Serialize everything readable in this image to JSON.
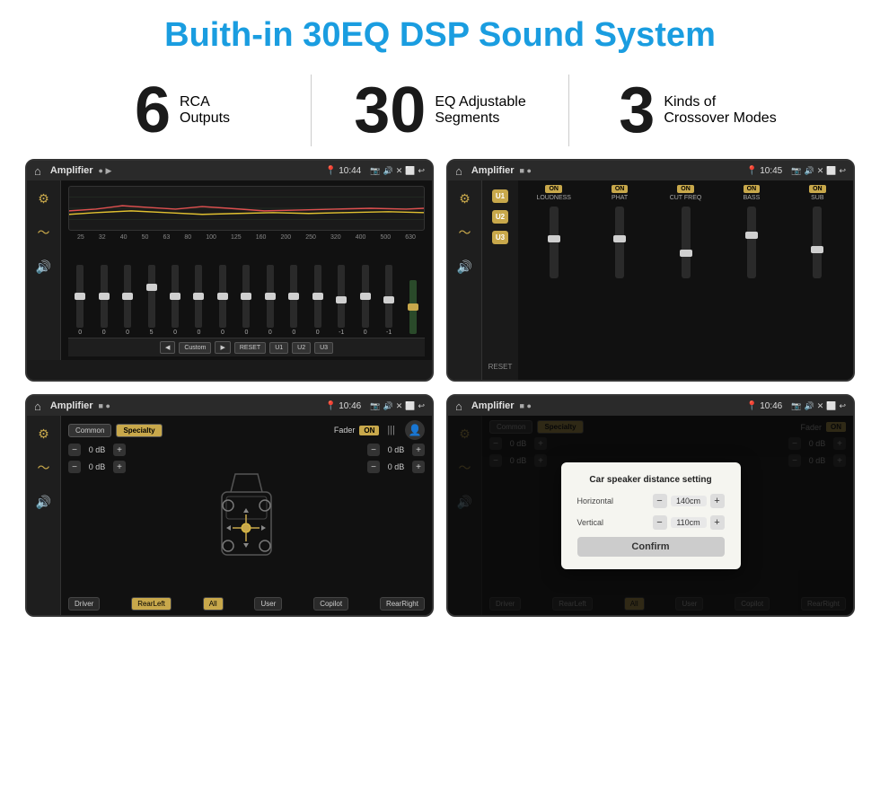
{
  "page": {
    "title": "Buith-in 30EQ DSP Sound System",
    "stats": [
      {
        "number": "6",
        "label_line1": "RCA",
        "label_line2": "Outputs"
      },
      {
        "number": "30",
        "label_line1": "EQ Adjustable",
        "label_line2": "Segments"
      },
      {
        "number": "3",
        "label_line1": "Kinds of",
        "label_line2": "Crossover Modes"
      }
    ]
  },
  "screens": [
    {
      "id": "eq-screen",
      "status": {
        "title": "Amplifier",
        "time": "10:44"
      },
      "type": "eq",
      "freqs": [
        "25",
        "32",
        "40",
        "50",
        "63",
        "80",
        "100",
        "125",
        "160",
        "200",
        "250",
        "320",
        "400",
        "500",
        "630"
      ],
      "values": [
        "0",
        "0",
        "0",
        "5",
        "0",
        "0",
        "0",
        "0",
        "0",
        "0",
        "0",
        "-1",
        "0",
        "-1"
      ],
      "presets": [
        "Custom",
        "RESET",
        "U1",
        "U2",
        "U3"
      ]
    },
    {
      "id": "amp2-screen",
      "status": {
        "title": "Amplifier",
        "time": "10:45"
      },
      "type": "amp2",
      "presets": [
        "U1",
        "U2",
        "U3"
      ],
      "channels": [
        {
          "on": true,
          "label": "LOUDNESS"
        },
        {
          "on": true,
          "label": "PHAT"
        },
        {
          "on": true,
          "label": "CUT FREQ"
        },
        {
          "on": true,
          "label": "BASS"
        },
        {
          "on": true,
          "label": "SUB"
        }
      ],
      "reset_label": "RESET"
    },
    {
      "id": "fader-screen",
      "status": {
        "title": "Amplifier",
        "time": "10:46"
      },
      "type": "fader",
      "tabs": [
        "Common",
        "Specialty"
      ],
      "fader_label": "Fader",
      "fader_on": "ON",
      "db_values": [
        "0 dB",
        "0 dB",
        "0 dB",
        "0 dB"
      ],
      "buttons": [
        "Driver",
        "RearLeft",
        "All",
        "User",
        "Copilot",
        "RearRight"
      ]
    },
    {
      "id": "dialog-screen",
      "status": {
        "title": "Amplifier",
        "time": "10:46"
      },
      "type": "dialog",
      "dialog": {
        "title": "Car speaker distance setting",
        "fields": [
          {
            "label": "Horizontal",
            "value": "140cm"
          },
          {
            "label": "Vertical",
            "value": "110cm"
          }
        ],
        "confirm_label": "Confirm"
      },
      "db_values": [
        "0 dB",
        "0 dB"
      ],
      "buttons": [
        "Driver",
        "RearLeft",
        "All",
        "User",
        "Copilot",
        "RearRight"
      ]
    }
  ]
}
